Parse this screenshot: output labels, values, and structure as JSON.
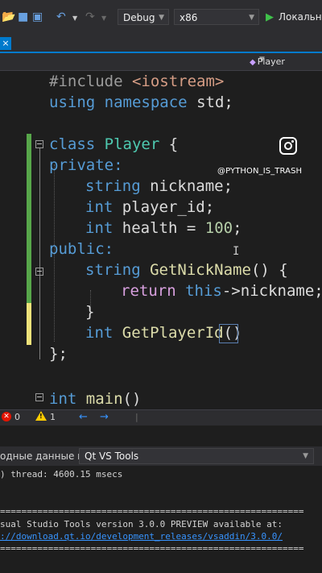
{
  "toolbar": {
    "config": "Debug",
    "platform": "x86",
    "run_label": "Локальн",
    "icons": [
      "open-folder-icon",
      "save-icon",
      "save-all-icon",
      "undo-icon",
      "redo-icon"
    ]
  },
  "tabs": {
    "close_glyph": "×"
  },
  "navbar": {
    "member": "Player"
  },
  "code": {
    "include": "#include",
    "header": "<iostream>",
    "using": "using",
    "namespace": "namespace",
    "std": "std;",
    "class_kw": "class",
    "class_name": "Player",
    "brace_open": "{",
    "private": "private:",
    "string": "string",
    "nickname_decl": "nickname;",
    "int": "int",
    "player_id_decl": "player_id;",
    "health_decl": "health =",
    "health_value": "100",
    "semicolon": ";",
    "public": "public:",
    "get_nick": "GetNickName",
    "parens_brace": "() {",
    "return": "return",
    "this": "this",
    "arrow": "->",
    "nickname_ret": "nickname;",
    "brace_close": "}",
    "get_id": "GetPlayerId",
    "paren_open": "(",
    "paren_close": ")",
    "class_end": "};",
    "main_name": "main",
    "main_parens": "()"
  },
  "watermark": {
    "handle": "@PYTHON_IS_TRASH"
  },
  "status": {
    "errors": "0",
    "warnings": "1",
    "back": "←",
    "forward": "→"
  },
  "output": {
    "source_label": "одные данные из:",
    "source_value": "Qt VS Tools",
    "lines": [
      ") thread: 4600.15 msecs",
      "",
      "",
      "=========================================================",
      "sual Studio Tools version 3.0.0 PREVIEW available at:"
    ],
    "link": "://download.qt.io/development_releases/vsaddin/3.0.0/",
    "rule_end": "========================================================="
  }
}
